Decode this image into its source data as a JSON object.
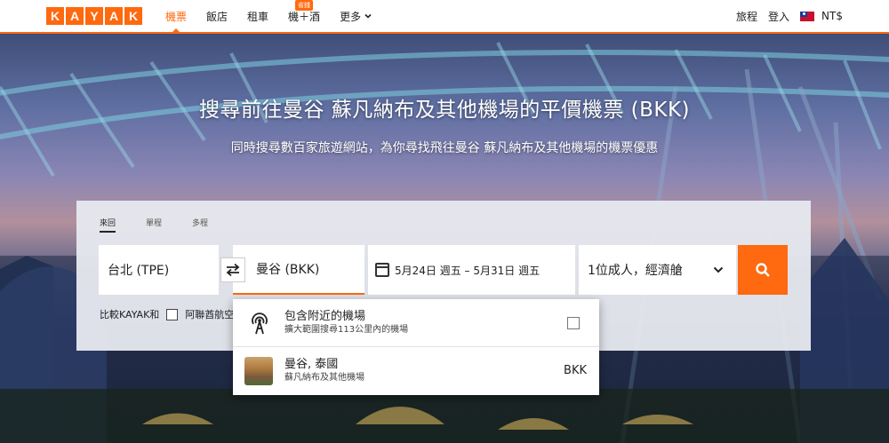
{
  "header": {
    "logo_letters": [
      "K",
      "A",
      "Y",
      "A",
      "K"
    ],
    "nav": [
      {
        "label": "機票",
        "active": true
      },
      {
        "label": "飯店",
        "active": false
      },
      {
        "label": "租車",
        "active": false
      },
      {
        "label": "機＋酒",
        "active": false,
        "badge": "省錢"
      },
      {
        "label": "更多",
        "active": false
      }
    ],
    "trips_label": "旅程",
    "signin_label": "登入",
    "currency": "NT$"
  },
  "hero": {
    "title": "搜尋前往曼谷 蘇凡納布及其他機場的平價機票 (BKK)",
    "subtitle": "同時搜尋數百家旅遊網站，為你尋找飛往曼谷 蘇凡納布及其他機場的機票優惠"
  },
  "search": {
    "trip_types": [
      {
        "label": "來回",
        "active": true
      },
      {
        "label": "單程",
        "active": false
      },
      {
        "label": "多程",
        "active": false
      }
    ],
    "origin": "台北 (TPE)",
    "destination": "曼谷 (BKK)",
    "dates": "5月24日 週五 – 5月31日 週五",
    "travelers": "1位成人，經濟艙",
    "compare_label": "比較KAYAK和",
    "compare_partner": "阿聯酋航空"
  },
  "dropdown": {
    "nearby": {
      "title": "包含附近的機場",
      "subtitle": "擴大範圍搜尋113公里內的機場"
    },
    "result": {
      "title": "曼谷, 泰國",
      "subtitle": "蘇凡納布及其他機場",
      "code": "BKK"
    }
  },
  "colors": {
    "brand": "#ff690f"
  }
}
